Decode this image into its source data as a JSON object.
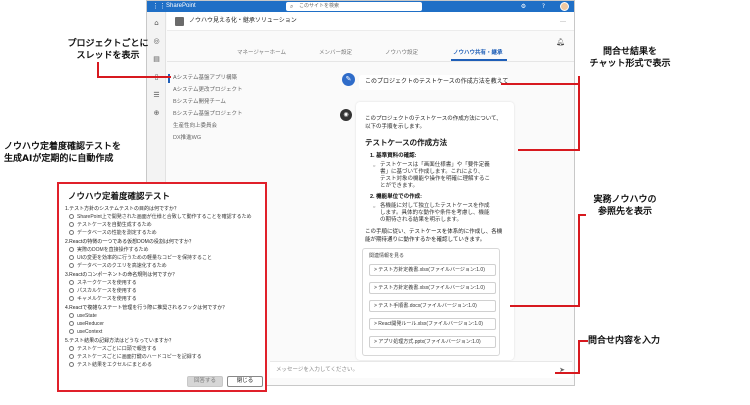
{
  "topbar": {
    "app_name": "SharePoint",
    "search_placeholder": "このサイトを検索"
  },
  "site": {
    "title": "ノウハウ見える化・継承ソリューション",
    "more": "…"
  },
  "tabs": [
    {
      "label": "マネージャーホーム"
    },
    {
      "label": "メンバー設定"
    },
    {
      "label": "ノウハウ設定"
    },
    {
      "label": "ノウハウ共有・継承"
    }
  ],
  "projects": [
    "Aシステム基盤アプリ構築",
    "Aシステム更改プロジェクト",
    "Bシステム開発チーム",
    "Bシステム基盤プロジェクト",
    "生産性向上委員会",
    "DX推進WG"
  ],
  "chat": {
    "question": "このプロジェクトのテストケースの作成方法を教えて",
    "answer_intro": [
      "このプロジェクトのテストケースの作成方法について、",
      "以下の手順を示します。"
    ],
    "answer_heading": "テストケースの作成方法",
    "step1_title": "1. 基準資料の確認:",
    "step1_bullets": [
      [
        "テストケースは「画面仕様書」や「要件定義",
        "書」に基づいて作成します。これにより、",
        "テスト対象の機能や操作を明確に理解するこ",
        "とができます。"
      ]
    ],
    "step2_title": "2. 機能単位での作成:",
    "step2_bullets": [
      [
        "各機能に対して独立したテストケースを作成",
        "します。具体的な動作や条件を考慮し、機能",
        "の期待される結果を明示します。"
      ]
    ],
    "answer_outro": [
      "この手順に従い、テストケースを体系的に作成し、各機",
      "能が期待通りに動作するかを確認していきます。"
    ],
    "refs_header": "関連情報を見る",
    "refs": [
      "> テスト方針定義書.xlsx(ファイルバージョン:1.0)",
      "> テスト方針定義書.xlsx(ファイルバージョン:1.0)",
      "> テスト手順書.docx(ファイルバージョン:1.0)",
      "> React開発ルール.xlsx(ファイルバージョン:1.0)",
      "> アプリ処理方式.pptx(ファイルバージョン:1.0)"
    ],
    "input_placeholder": "メッセージを入力してください。"
  },
  "quiz": {
    "title": "ノウハウ定着度確認テスト",
    "questions": [
      {
        "q": "1.テスト方針のシステムテストの目的は何ですか？",
        "options": [
          "SharePoint上で開発された画面が仕様と合致して動作することを確認するため",
          "テストケースを自動生成するため",
          "データベースの性能を測定するため"
        ]
      },
      {
        "q": "2.Reactの特徴の一つである仮想DOMの役割は何ですか？",
        "options": [
          "実際のDOMを直接操作するため",
          "UIの変更を効率的に行うための軽量なコピーを保持すること",
          "データベースのクエリを高速化するため"
        ]
      },
      {
        "q": "3.Reactのコンポーネントの命名規則は何ですか？",
        "options": [
          "スネークケースを使用する",
          "パスカルケースを使用する",
          "キャメルケースを使用する"
        ]
      },
      {
        "q": "4.Reactで複雑なステート管理を行う際に推奨されるフックは何ですか？",
        "options": [
          "useState",
          "useReducer",
          "useContext"
        ]
      },
      {
        "q": "5.テスト結果の記録方法はどうなっていますか？",
        "options": [
          "テストケースごとに口頭で報告する",
          "テストケースごとに画面打鍵のハードコピーを記録する",
          "テスト結果をエクセルにまとめる"
        ]
      }
    ],
    "submit_label": "回答する",
    "close_label": "閉じる"
  },
  "annotations": {
    "thread": [
      "プロジェクトごとに",
      "スレッドを表示"
    ],
    "quiz": [
      "ノウハウ定着度確認テストを",
      "生成AIが定期的に自動作成"
    ],
    "chat": [
      "問合せ結果を",
      "チャット形式で表示"
    ],
    "refs": [
      "実務ノウハウの",
      "参照先を表示"
    ],
    "input": [
      "問合せ内容を入力"
    ]
  },
  "colors": {
    "accent": "#1f6fc6",
    "annotation": "#d7191f"
  }
}
